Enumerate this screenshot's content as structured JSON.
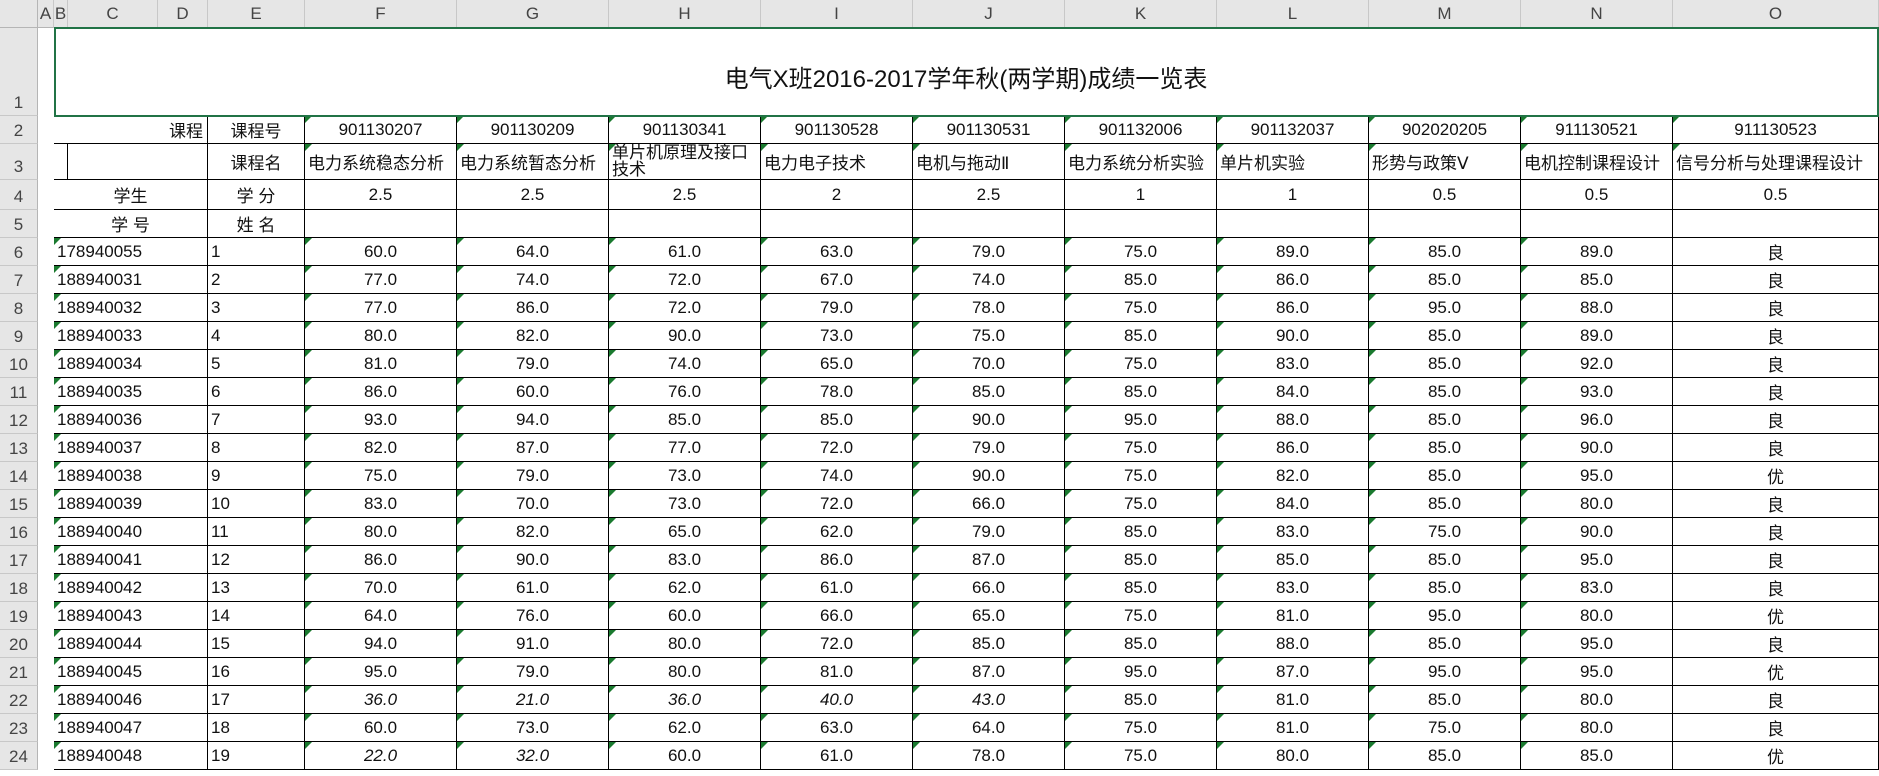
{
  "title": "电气X班2016-2017学年秋(两学期)成绩一览表",
  "columns": [
    "A",
    "B",
    "C",
    "D",
    "E",
    "F",
    "G",
    "H",
    "I",
    "J",
    "K",
    "L",
    "M",
    "N",
    "O"
  ],
  "rows": [
    "1",
    "2",
    "3",
    "4",
    "5",
    "6",
    "7",
    "8",
    "9",
    "10",
    "11",
    "12",
    "13",
    "14",
    "15",
    "16",
    "17",
    "18",
    "19",
    "20",
    "21",
    "22",
    "23",
    "24"
  ],
  "labels": {
    "course": "课程",
    "course_no": "课程号",
    "course_name": "课程名",
    "student": "学生",
    "credit": "学 分",
    "student_no": "学 号",
    "name": "姓 名"
  },
  "courses": [
    {
      "no": "901130207",
      "name": "电力系统稳态分析",
      "credit": "2.5"
    },
    {
      "no": "901130209",
      "name": "电力系统暂态分析",
      "credit": "2.5"
    },
    {
      "no": "901130341",
      "name": "单片机原理及接口技术",
      "credit": "2.5"
    },
    {
      "no": "901130528",
      "name": "电力电子技术",
      "credit": "2"
    },
    {
      "no": "901130531",
      "name": "电机与拖动Ⅱ",
      "credit": "2.5"
    },
    {
      "no": "901132006",
      "name": "电力系统分析实验",
      "credit": "1"
    },
    {
      "no": "901132037",
      "name": "单片机实验",
      "credit": "1"
    },
    {
      "no": "902020205",
      "name": "形势与政策Ⅴ",
      "credit": "0.5"
    },
    {
      "no": "911130521",
      "name": "电机控制课程设计",
      "credit": "0.5"
    },
    {
      "no": "911130523",
      "name": "信号分析与处理课程设计",
      "credit": "0.5"
    }
  ],
  "students": [
    {
      "id": "178940055",
      "name": "1",
      "scores": [
        "60.0",
        "64.0",
        "61.0",
        "63.0",
        "79.0",
        "75.0",
        "89.0",
        "85.0",
        "89.0",
        "良"
      ],
      "italic": []
    },
    {
      "id": "188940031",
      "name": "2",
      "scores": [
        "77.0",
        "74.0",
        "72.0",
        "67.0",
        "74.0",
        "85.0",
        "86.0",
        "85.0",
        "85.0",
        "良"
      ],
      "italic": []
    },
    {
      "id": "188940032",
      "name": "3",
      "scores": [
        "77.0",
        "86.0",
        "72.0",
        "79.0",
        "78.0",
        "75.0",
        "86.0",
        "95.0",
        "88.0",
        "良"
      ],
      "italic": []
    },
    {
      "id": "188940033",
      "name": "4",
      "scores": [
        "80.0",
        "82.0",
        "90.0",
        "73.0",
        "75.0",
        "85.0",
        "90.0",
        "85.0",
        "89.0",
        "良"
      ],
      "italic": []
    },
    {
      "id": "188940034",
      "name": "5",
      "scores": [
        "81.0",
        "79.0",
        "74.0",
        "65.0",
        "70.0",
        "75.0",
        "83.0",
        "85.0",
        "92.0",
        "良"
      ],
      "italic": []
    },
    {
      "id": "188940035",
      "name": "6",
      "scores": [
        "86.0",
        "60.0",
        "76.0",
        "78.0",
        "85.0",
        "85.0",
        "84.0",
        "85.0",
        "93.0",
        "良"
      ],
      "italic": []
    },
    {
      "id": "188940036",
      "name": "7",
      "scores": [
        "93.0",
        "94.0",
        "85.0",
        "85.0",
        "90.0",
        "95.0",
        "88.0",
        "85.0",
        "96.0",
        "良"
      ],
      "italic": []
    },
    {
      "id": "188940037",
      "name": "8",
      "scores": [
        "82.0",
        "87.0",
        "77.0",
        "72.0",
        "79.0",
        "75.0",
        "86.0",
        "85.0",
        "90.0",
        "良"
      ],
      "italic": []
    },
    {
      "id": "188940038",
      "name": "9",
      "scores": [
        "75.0",
        "79.0",
        "73.0",
        "74.0",
        "90.0",
        "75.0",
        "82.0",
        "85.0",
        "95.0",
        "优"
      ],
      "italic": []
    },
    {
      "id": "188940039",
      "name": "10",
      "scores": [
        "83.0",
        "70.0",
        "73.0",
        "72.0",
        "66.0",
        "75.0",
        "84.0",
        "85.0",
        "80.0",
        "良"
      ],
      "italic": []
    },
    {
      "id": "188940040",
      "name": "11",
      "scores": [
        "80.0",
        "82.0",
        "65.0",
        "62.0",
        "79.0",
        "85.0",
        "83.0",
        "75.0",
        "90.0",
        "良"
      ],
      "italic": []
    },
    {
      "id": "188940041",
      "name": "12",
      "scores": [
        "86.0",
        "90.0",
        "83.0",
        "86.0",
        "87.0",
        "85.0",
        "85.0",
        "85.0",
        "95.0",
        "良"
      ],
      "italic": []
    },
    {
      "id": "188940042",
      "name": "13",
      "scores": [
        "70.0",
        "61.0",
        "62.0",
        "61.0",
        "66.0",
        "85.0",
        "83.0",
        "85.0",
        "83.0",
        "良"
      ],
      "italic": []
    },
    {
      "id": "188940043",
      "name": "14",
      "scores": [
        "64.0",
        "76.0",
        "60.0",
        "66.0",
        "65.0",
        "75.0",
        "81.0",
        "95.0",
        "80.0",
        "优"
      ],
      "italic": []
    },
    {
      "id": "188940044",
      "name": "15",
      "scores": [
        "94.0",
        "91.0",
        "80.0",
        "72.0",
        "85.0",
        "85.0",
        "88.0",
        "85.0",
        "95.0",
        "良"
      ],
      "italic": []
    },
    {
      "id": "188940045",
      "name": "16",
      "scores": [
        "95.0",
        "79.0",
        "80.0",
        "81.0",
        "87.0",
        "95.0",
        "87.0",
        "95.0",
        "95.0",
        "优"
      ],
      "italic": []
    },
    {
      "id": "188940046",
      "name": "17",
      "scores": [
        "36.0",
        "21.0",
        "36.0",
        "40.0",
        "43.0",
        "85.0",
        "81.0",
        "85.0",
        "80.0",
        "良"
      ],
      "italic": [
        0,
        1,
        2,
        3,
        4
      ]
    },
    {
      "id": "188940047",
      "name": "18",
      "scores": [
        "60.0",
        "73.0",
        "62.0",
        "63.0",
        "64.0",
        "75.0",
        "81.0",
        "75.0",
        "80.0",
        "良"
      ],
      "italic": []
    },
    {
      "id": "188940048",
      "name": "19",
      "scores": [
        "22.0",
        "32.0",
        "60.0",
        "61.0",
        "78.0",
        "75.0",
        "80.0",
        "85.0",
        "85.0",
        "优"
      ],
      "italic": [
        0,
        1
      ]
    }
  ],
  "colors": {
    "grid_header_bg": "#e6e6e6",
    "error_marker": "#1a7a2f",
    "selection": "#217346"
  }
}
